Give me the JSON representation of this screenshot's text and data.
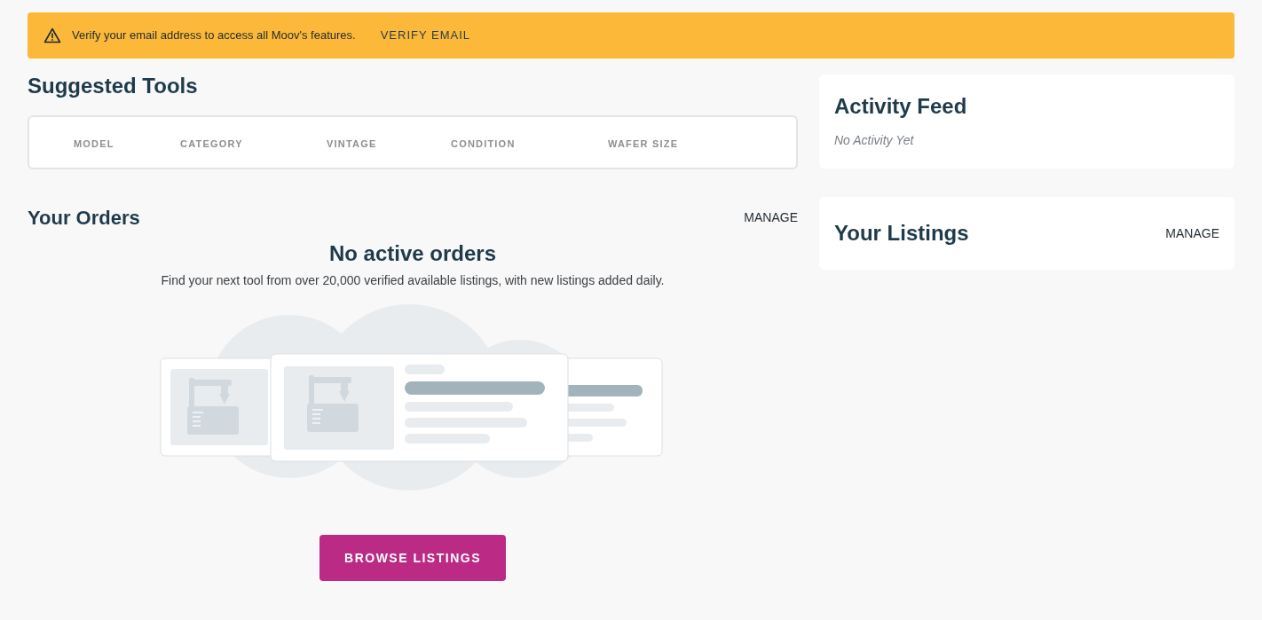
{
  "banner": {
    "message": "Verify your email address to access all Moov's features.",
    "action": "VERIFY EMAIL"
  },
  "suggested_tools": {
    "title": "Suggested Tools",
    "columns": [
      "MODEL",
      "CATEGORY",
      "VINTAGE",
      "CONDITION",
      "WAFER SIZE"
    ]
  },
  "orders": {
    "title": "Your Orders",
    "action": "MANAGE",
    "empty_title": "No active orders",
    "empty_text": "Find your next tool from over 20,000 verified available listings, with new listings added daily.",
    "button": "BROWSE LISTINGS"
  },
  "activity_feed": {
    "title": "Activity Feed",
    "empty_text": "No Activity Yet"
  },
  "listings": {
    "title": "Your Listings",
    "action": "MANAGE"
  }
}
